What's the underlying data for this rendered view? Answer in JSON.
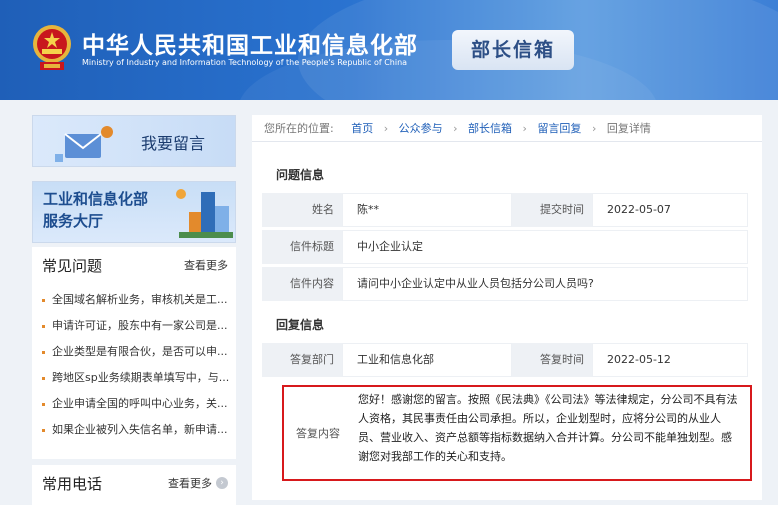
{
  "header": {
    "title": "中华人民共和国工业和信息化部",
    "subtitle": "Ministry of Industry and Information Technology of the People's Republic of China",
    "badge": "部长信箱"
  },
  "left": {
    "leave_message": "我要留言",
    "hall_line1": "工业和信息化部",
    "hall_line2": "服务大厅",
    "faq_title": "常见问题",
    "more_label": "查看更多",
    "faq_items": [
      "全国域名解析业务，审核机关是工...",
      "申请许可证，股东中有一家公司是...",
      "企业类型是有限合伙，是否可以申...",
      "跨地区sp业务续期表单填写中，与...",
      "企业申请全国的呼叫中心业务，关...",
      "如果企业被列入失信名单，新申请..."
    ],
    "phone_title": "常用电话"
  },
  "breadcrumb": {
    "prefix": "您所在的位置:",
    "items": [
      "首页",
      "公众参与",
      "部长信箱",
      "留言回复"
    ],
    "current": "回复详情"
  },
  "question": {
    "section_title": "问题信息",
    "name_label": "姓名",
    "name_value": "陈**",
    "submit_label": "提交时间",
    "submit_value": "2022-05-07",
    "subject_label": "信件标题",
    "subject_value": "中小企业认定",
    "content_label": "信件内容",
    "content_value": "请问中小企业认定中从业人员包括分公司人员吗?"
  },
  "answer": {
    "section_title": "回复信息",
    "dept_label": "答复部门",
    "dept_value": "工业和信息化部",
    "time_label": "答复时间",
    "time_value": "2022-05-12",
    "content_label": "答复内容",
    "content_value": "您好！感谢您的留言。按照《民法典》《公司法》等法律规定，分公司不具有法人资格，其民事责任由公司承担。所以，企业划型时，应将分公司的从业人员、营业收入、资产总额等指标数据纳入合并计算。分公司不能单独划型。感谢您对我部工作的关心和支持。"
  },
  "colors": {
    "header_blue": "#1f5fb8",
    "highlight_border": "#d7191c",
    "bullet": "#e38a2c"
  }
}
